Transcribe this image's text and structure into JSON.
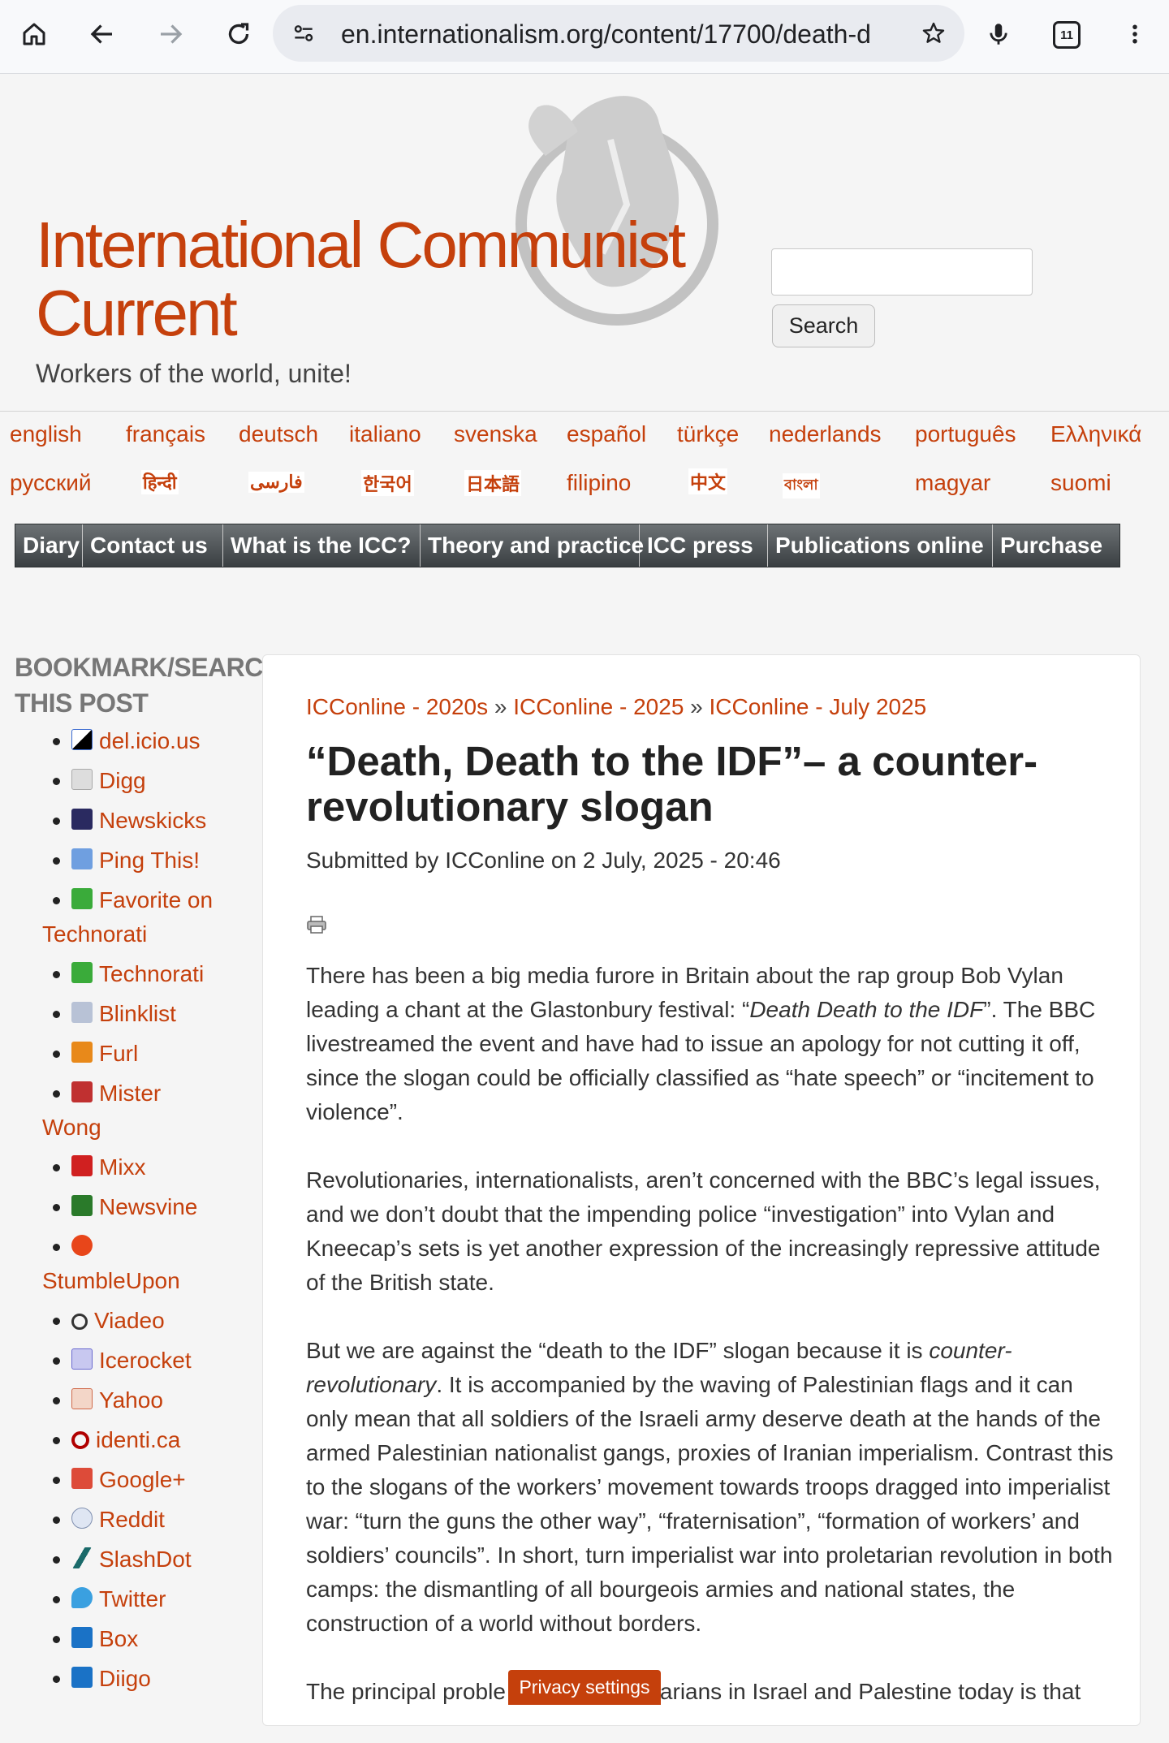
{
  "browser": {
    "url": "en.internationalism.org/content/17700/death-d",
    "tab_count": "11"
  },
  "header": {
    "site_name": "International Communist Current",
    "slogan": "Workers of the world, unite!",
    "search_button": "Search"
  },
  "languages": [
    "english",
    "français",
    "deutsch",
    "italiano",
    "svenska",
    "español",
    "türkçe",
    "nederlands",
    "português",
    "Ελληνικά",
    "русский",
    "हिन्दी",
    "فارسی",
    "한국어",
    "日本語",
    "filipino",
    "中文",
    "বাংলা",
    "magyar",
    "suomi"
  ],
  "menu": [
    "Diary",
    "Contact us",
    "What is the ICC?",
    "Theory and practice",
    "ICC press",
    "Publications online",
    "Purchase"
  ],
  "sidebar": {
    "title": "BOOKMARK/SEARCH THIS POST",
    "items": [
      {
        "label": "del.icio.us",
        "icon": "delicious-icon",
        "color": "#000000"
      },
      {
        "label": "Digg",
        "icon": "digg-icon",
        "color": "#bbbbbb"
      },
      {
        "label": "Newskicks",
        "icon": "newskicks-icon",
        "color": "#2a2a60"
      },
      {
        "label": "Ping This!",
        "icon": "ping-icon",
        "color": "#6f9fe0"
      },
      {
        "label": "Favorite on Technorati",
        "icon": "technorati-icon",
        "color": "#3aab3a"
      },
      {
        "label": "Technorati",
        "icon": "technorati-icon",
        "color": "#3aab3a"
      },
      {
        "label": "Blinklist",
        "icon": "blinklist-icon",
        "color": "#7a8aa8"
      },
      {
        "label": "Furl",
        "icon": "furl-icon",
        "color": "#e8891a"
      },
      {
        "label": "Mister Wong",
        "icon": "misterwong-icon",
        "color": "#c03030"
      },
      {
        "label": "Mixx",
        "icon": "mixx-icon",
        "color": "#d02020"
      },
      {
        "label": "Newsvine",
        "icon": "newsvine-icon",
        "color": "#2a7a2a"
      },
      {
        "label": "StumbleUpon",
        "icon": "stumbleupon-icon",
        "color": "#e8461a"
      },
      {
        "label": "Viadeo",
        "icon": "viadeo-icon",
        "color": "#333333"
      },
      {
        "label": "Icerocket",
        "icon": "icerocket-icon",
        "color": "#6a6ad0"
      },
      {
        "label": "Yahoo",
        "icon": "yahoo-icon",
        "color": "#d06a4a"
      },
      {
        "label": "identi.ca",
        "icon": "identica-icon",
        "color": "#b00000"
      },
      {
        "label": "Google+",
        "icon": "googleplus-icon",
        "color": "#dd4b39"
      },
      {
        "label": "Reddit",
        "icon": "reddit-icon",
        "color": "#8090b0"
      },
      {
        "label": "SlashDot",
        "icon": "slashdot-icon",
        "color": "#1a6a6a"
      },
      {
        "label": "Twitter",
        "icon": "twitter-icon",
        "color": "#3aa0e0"
      },
      {
        "label": "Box",
        "icon": "box-icon",
        "color": "#1a72c6"
      },
      {
        "label": "Diigo",
        "icon": "diigo-icon",
        "color": "#1a72c6"
      }
    ]
  },
  "article": {
    "breadcrumb": [
      "ICConline - 2020s",
      "ICConline - 2025",
      "ICConline - July 2025"
    ],
    "breadcrumb_sep": "»",
    "title": "“Death, Death to the IDF”– a counter-revolutionary slogan",
    "submitted": "Submitted by ICConline on 2 July, 2025 - 20:46",
    "p1_a": "There has been a big media furore in Britain about the rap group Bob Vylan leading a chant at the Glastonbury festival: “",
    "p1_em": "Death Death to the IDF",
    "p1_b": "”. The BBC livestreamed the event and have had to issue an apology for not cutting it off, since the slogan could be officially classified as “hate speech” or “incitement to violence”.",
    "p2": "Revolutionaries, internationalists, aren’t concerned with the BBC’s legal issues, and we don’t doubt that the impending police “investigation” into Vylan and Kneecap’s sets is yet another expression of the increasingly repressive attitude of the British state.",
    "p3_a": "But we are against the “death to the IDF” slogan because it is ",
    "p3_em": "counter-revolutionary",
    "p3_b": ". It is accompanied by the waving of Palestinian flags and it can only mean that all soldiers of the Israeli army deserve death at the hands of the armed Palestinian nationalist gangs, proxies of Iranian imperialism. Contrast this to the slogans of the workers’ movement towards troops dragged into imperialist war: “turn the guns the other way”, “fraternisation”, “formation of workers’ and soldiers’ councils”. In short, turn imperialist war into proletarian revolution in both camps: the dismantling of all bourgeois armies and national states, the construction of a world without borders.",
    "p4": "The principal proble",
    "p4_hidden": "arians in Israel and Palestine today is that"
  },
  "privacy_button": "Privacy settings",
  "colors": {
    "accent": "#c5400c",
    "menu": "#4a4f52"
  }
}
